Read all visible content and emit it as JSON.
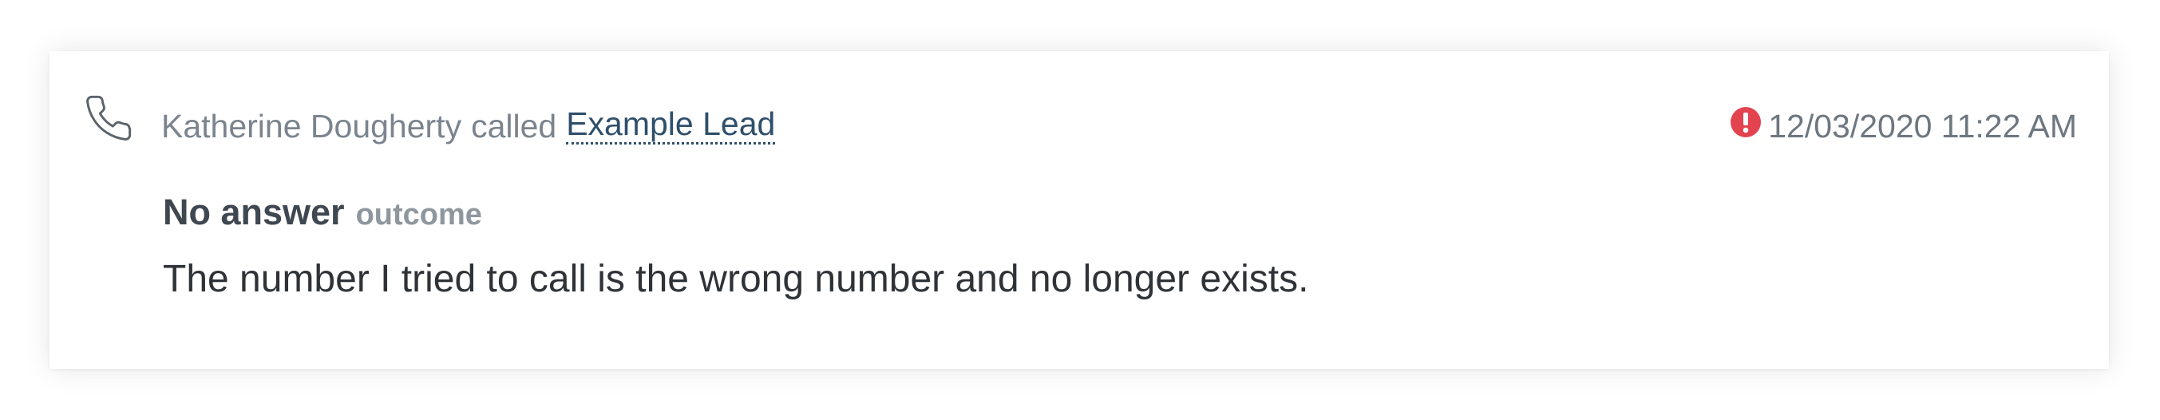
{
  "activity": {
    "icon": "phone-icon",
    "caller": "Katherine Dougherty",
    "action": "called",
    "lead_name": "Example Lead",
    "status_icon": "alert-icon",
    "timestamp": "12/03/2020 11:22 AM",
    "outcome_value": "No answer",
    "outcome_label": "outcome",
    "note": "The number I tried to call is the wrong number and no longer exists."
  },
  "colors": {
    "alert": "#e2434f",
    "link": "#2f4f6b",
    "muted_text": "#7b848e",
    "body_text": "#2f3338"
  }
}
